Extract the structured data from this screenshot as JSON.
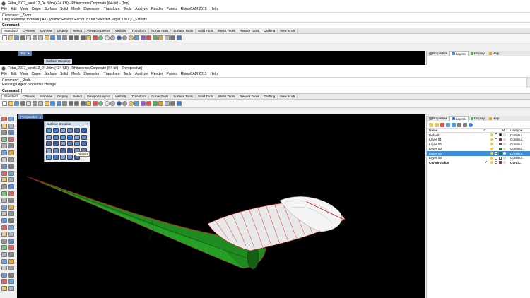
{
  "back_window": {
    "title": "Feba_2017_week12_04.3dm (424 KB) - Rhinoceros Corporate (64-bit) - [Top]",
    "menu": [
      "File",
      "Edit",
      "View",
      "Curve",
      "Surface",
      "Solid",
      "Mesh",
      "Dimension",
      "Transform",
      "Tools",
      "Analyze",
      "Render",
      "Panels",
      "RhinoCAM 2015",
      "Help"
    ],
    "history": [
      "Command: _Zoom",
      "Drag a window to zoom ( All  Dynamic  Extents  Factor  In  Out  Selected  Target  1To1 ): _Extents"
    ],
    "command_label": "Command:",
    "tabs": [
      "Standard",
      "CPlanes",
      "Set View",
      "Display",
      "Select",
      "Viewport Layout",
      "Visibility",
      "Transform",
      "Curve Tools",
      "Surface Tools",
      "Solid Tools",
      "Mesh Tools",
      "Render Tools",
      "Drafting",
      "New in V5"
    ],
    "viewport_label": "Top",
    "float_label": "Surface Creation",
    "panel_tabs": [
      "Properties",
      "Layers",
      "Display",
      "Help"
    ]
  },
  "front_window": {
    "title": "Feba_2017_week12_04.3dm (424 KB) - Rhinoceros Corporate (64-bit) - [Perspective]",
    "menu": [
      "File",
      "Edit",
      "View",
      "Curve",
      "Surface",
      "Solid",
      "Mesh",
      "Dimension",
      "Transform",
      "Tools",
      "Analyze",
      "Render",
      "Panels",
      "RhinoCAM 2015",
      "Help"
    ],
    "history": [
      "Command: _Redo",
      "Redoing Object properties change"
    ],
    "command_label": "Command:",
    "tabs": [
      "Standard",
      "CPlanes",
      "Set View",
      "Display",
      "Select",
      "Viewport Layout",
      "Visibility",
      "Transform",
      "Curve Tools",
      "Surface Tools",
      "Solid Tools",
      "Mesh Tools",
      "Render Tools",
      "Drafting",
      "New in V5"
    ],
    "viewport_label": "Perspective",
    "float_panel": {
      "title": "Surface Creation",
      "tooltip": "Ribbon"
    },
    "panel_tabs": [
      "Properties",
      "Layers",
      "Display",
      "Help"
    ],
    "layers_header": {
      "name": "Name",
      "current": "C...",
      "material": "M...",
      "linetype": "Linetype"
    },
    "layers": [
      {
        "name": "Default",
        "current": "",
        "color": "#000000",
        "linetype": "Continu...",
        "selected": false,
        "bold": false
      },
      {
        "name": "Layer 01",
        "current": "",
        "color": "#ff0000",
        "linetype": "Continu...",
        "selected": false,
        "bold": false
      },
      {
        "name": "Layer 02",
        "current": "",
        "color": "#8b1a8b",
        "linetype": "Continu...",
        "selected": false,
        "bold": false
      },
      {
        "name": "Layer 03",
        "current": "",
        "color": "#00a000",
        "linetype": "Continu...",
        "selected": false,
        "bold": false
      },
      {
        "name": "Layer 04",
        "current": "",
        "color": "#00a000",
        "linetype": "Continu...",
        "selected": true,
        "bold": false
      },
      {
        "name": "Layer 05",
        "current": "",
        "color": "#ffffff",
        "linetype": "Continu...",
        "selected": false,
        "bold": false
      },
      {
        "name": "Construction",
        "current": "✓",
        "color": "#cc0000",
        "linetype": "Conti...",
        "selected": false,
        "bold": true
      }
    ]
  },
  "colors": {
    "viewport_bg": "#000000",
    "label_bg": "#5b7fae",
    "selection": "#3c8fd8",
    "hull_green": "#1f8a1f",
    "edge_red": "#d21a1a",
    "surface_white": "#e8e8e8"
  },
  "icons": [
    "rhino-app-icon",
    "new-file-icon",
    "open-icon",
    "save-icon",
    "print-icon",
    "cut-icon",
    "copy-icon",
    "paste-icon",
    "undo-icon",
    "pan-icon",
    "rotate-view-icon",
    "zoom-icon",
    "zoom-window-icon",
    "zoom-extents-icon",
    "shade-icon",
    "render-icon",
    "light-bulb-icon",
    "lock-icon",
    "help-icon"
  ]
}
